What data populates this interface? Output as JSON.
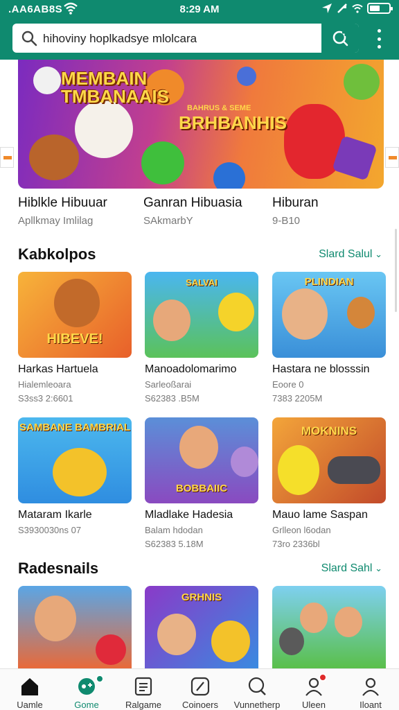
{
  "status": {
    "carrier": ".AA6AB8S",
    "time": "8:29 AM"
  },
  "search": {
    "query": "hihoviny hoplkadsye mlolcara"
  },
  "banner": {
    "title_line1": "MEMBAIN",
    "title_line2": "TMBANAAIS",
    "center_title": "BRHBANHIS",
    "center_small": "BAHRUS & SEME"
  },
  "banner_captions": [
    {
      "title": "Hiblkle Hibuuar",
      "sub": "Apllkmay Imlilag"
    },
    {
      "title": "Ganran Hibuasia",
      "sub": "SAkmarbY"
    },
    {
      "title": "Hiburan",
      "sub": "9-B10"
    }
  ],
  "section1": {
    "title": "Kabkolpos",
    "see_all": "Slard Salul",
    "cards": [
      {
        "thumb_label": "HIBEVE!",
        "name": "Harkas Hartuela",
        "meta": "Hialemleoara",
        "meta2": "S3ss3 2:6601"
      },
      {
        "thumb_label": "SALVAI",
        "name": "Manoadolomarimo",
        "meta": "Sarleoßarai",
        "meta2": "S62383 .B5M"
      },
      {
        "thumb_label": "PLINDIAN",
        "name": "Hastara ne blosssin",
        "meta": "Eoore 0",
        "meta2": "7383 2205M"
      },
      {
        "thumb_label": "SAMBANE BAMBRIAL",
        "name": "Mataram Ikarle",
        "meta": "",
        "meta2": "S3930030ns 07"
      },
      {
        "thumb_label": "BOBBAIIC",
        "name": "Mladlake Hadesia",
        "meta": "Balam hdodan",
        "meta2": "S62383 5.18M"
      },
      {
        "thumb_label": "MOKNINS",
        "name": "Mauo lame Saspan",
        "meta": "Grlleon l6odan",
        "meta2": "73ro 2336bl"
      }
    ]
  },
  "section2": {
    "title": "Radesnails",
    "see_all": "Slard Sahl",
    "cards": [
      {
        "thumb_label": ""
      },
      {
        "thumb_label": "GRHNIS"
      },
      {
        "thumb_label": ""
      }
    ]
  },
  "bottom_nav": [
    {
      "label": "Uamle",
      "icon": "home-icon"
    },
    {
      "label": "Gome",
      "icon": "game-controller-icon"
    },
    {
      "label": "Ralgame",
      "icon": "list-icon"
    },
    {
      "label": "Coinoers",
      "icon": "compass-icon"
    },
    {
      "label": "Vunnetherp",
      "icon": "chat-icon"
    },
    {
      "label": "Uleen",
      "icon": "users-icon"
    },
    {
      "label": "Iloant",
      "icon": "profile-icon"
    }
  ],
  "colors": {
    "brand": "#0f8a6f",
    "accent": "#ffd84a",
    "badge": "#e02a2a"
  }
}
